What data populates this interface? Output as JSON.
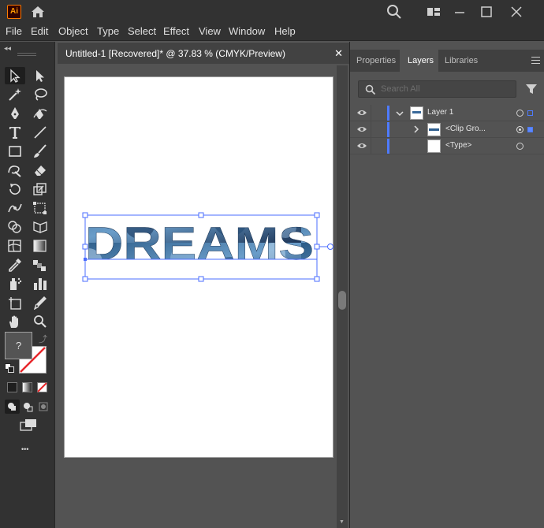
{
  "app": {
    "logo": "Ai"
  },
  "menu": [
    "File",
    "Edit",
    "Object",
    "Type",
    "Select",
    "Effect",
    "View",
    "Window",
    "Help"
  ],
  "document": {
    "tab_title": "Untitled-1 [Recovered]* @ 37.83 % (CMYK/Preview)",
    "close_glyph": "✕",
    "artwork_text": "DREAMS"
  },
  "toolbar": {
    "fill_unknown_glyph": "?",
    "more_glyph": "•••"
  },
  "panel": {
    "tabs": [
      "Properties",
      "Layers",
      "Libraries"
    ],
    "active_tab": "Layers",
    "search_placeholder": "Search All",
    "layers": [
      {
        "name": "Layer 1"
      },
      {
        "name": "<Clip Gro..."
      },
      {
        "name": "<Type>"
      }
    ]
  },
  "colors": {
    "chrome": "#323232",
    "workspace": "#535353",
    "accent_blue": "#4e7bff",
    "selection_blue": "#4a6cff"
  }
}
